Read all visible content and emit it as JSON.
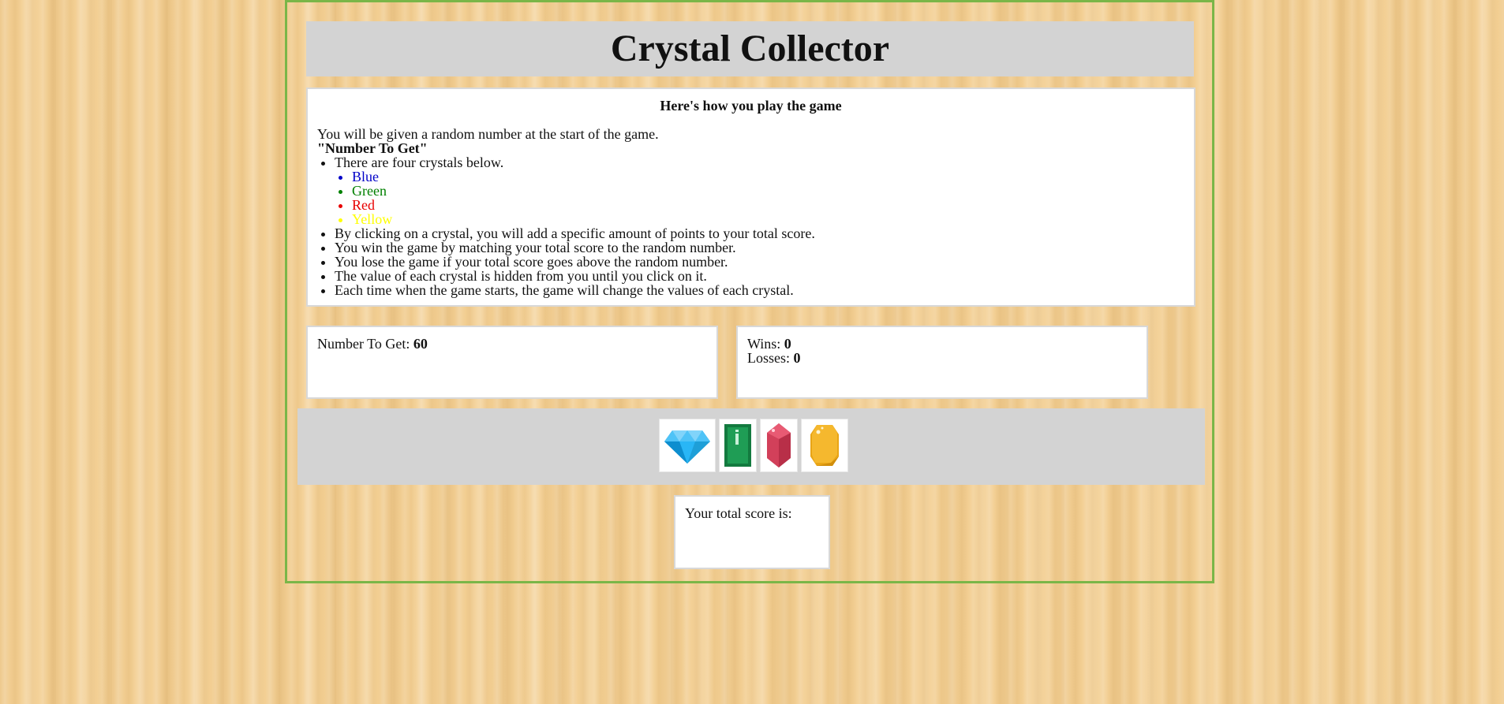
{
  "game": {
    "title": "Crystal Collector"
  },
  "instructions": {
    "heading": "Here's how you play the game",
    "intro": "You will be given a random number at the start of the game.",
    "number_label": "\"Number To Get\"",
    "rules_first": "There are four crystals below.",
    "crystal_colors": [
      {
        "label": "Blue",
        "color": "#0000c8"
      },
      {
        "label": "Green",
        "color": "#008000"
      },
      {
        "label": "Red",
        "color": "#e80000"
      },
      {
        "label": "Yellow",
        "color": "#ffff00"
      }
    ],
    "rules_rest": [
      "By clicking on a crystal, you will add a specific amount of points to your total score.",
      "You win the game by matching your total score to the random number.",
      "You lose the game if your total score goes above the random number.",
      "The value of each crystal is hidden from you until you click on it.",
      "Each time when the game starts, the game will change the values of each crystal."
    ]
  },
  "target": {
    "label": "Number To Get: ",
    "value": "60"
  },
  "record": {
    "wins_label": "Wins: ",
    "wins": "0",
    "losses_label": "Losses: ",
    "losses": "0"
  },
  "crystals": [
    {
      "name": "blue-diamond-icon",
      "color": "#29b6f6"
    },
    {
      "name": "green-emerald-icon",
      "color": "#1f9d55"
    },
    {
      "name": "red-ruby-icon",
      "color": "#d2405a"
    },
    {
      "name": "yellow-topaz-icon",
      "color": "#f5b82e"
    }
  ],
  "total": {
    "label": "Your total score is:",
    "value": ""
  },
  "colors": {
    "frame_border": "#7ab648",
    "panel_gray": "#d3d3d3"
  }
}
